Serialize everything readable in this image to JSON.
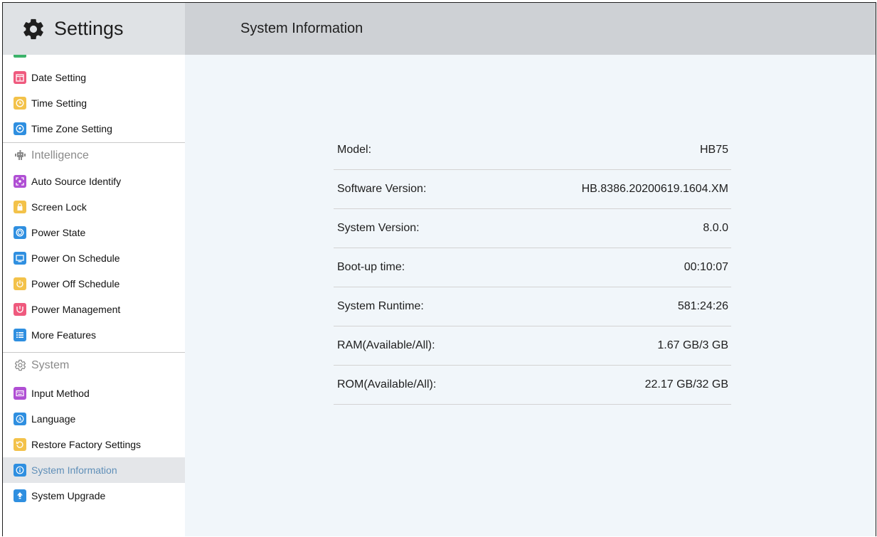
{
  "header": {
    "app_title": "Settings",
    "page_title": "System Information"
  },
  "sidebar": {
    "items_top": [
      {
        "label": "Date Setting",
        "icon": "calendar-icon",
        "color": "#ef5a7e"
      },
      {
        "label": "Time Setting",
        "icon": "clock-icon",
        "color": "#f3c24a"
      },
      {
        "label": "Time Zone Setting",
        "icon": "location-icon",
        "color": "#2f8fe0"
      }
    ],
    "section_intelligence": "Intelligence",
    "items_intelligence": [
      {
        "label": "Auto Source Identify",
        "icon": "source-icon",
        "color": "#b04fd4"
      },
      {
        "label": "Screen Lock",
        "icon": "lock-icon",
        "color": "#f3c24a"
      },
      {
        "label": "Power State",
        "icon": "power-state-icon",
        "color": "#2f8fe0"
      },
      {
        "label": "Power On Schedule",
        "icon": "monitor-icon",
        "color": "#2f8fe0"
      },
      {
        "label": "Power Off Schedule",
        "icon": "power-icon",
        "color": "#f3c24a"
      },
      {
        "label": "Power Management",
        "icon": "power-management-icon",
        "color": "#ef5a7e"
      },
      {
        "label": "More Features",
        "icon": "list-icon",
        "color": "#2f8fe0"
      }
    ],
    "section_system": "System",
    "items_system": [
      {
        "label": "Input Method",
        "icon": "keyboard-icon",
        "color": "#b04fd4"
      },
      {
        "label": "Language",
        "icon": "language-icon",
        "color": "#2f8fe0"
      },
      {
        "label": "Restore Factory Settings",
        "icon": "restore-icon",
        "color": "#f3c24a"
      },
      {
        "label": "System Information",
        "icon": "info-icon",
        "color": "#2f8fe0"
      },
      {
        "label": "System Upgrade",
        "icon": "upgrade-icon",
        "color": "#2f8fe0"
      }
    ]
  },
  "info": [
    {
      "label": "Model:",
      "value": "HB75"
    },
    {
      "label": "Software Version:",
      "value": "HB.8386.20200619.1604.XM"
    },
    {
      "label": "System Version:",
      "value": "8.0.0"
    },
    {
      "label": "Boot-up time:",
      "value": "00:10:07"
    },
    {
      "label": "System Runtime:",
      "value": "581:24:26"
    },
    {
      "label": "RAM(Available/All):",
      "value": "1.67 GB/3 GB"
    },
    {
      "label": "ROM(Available/All):",
      "value": "22.17 GB/32 GB"
    }
  ]
}
